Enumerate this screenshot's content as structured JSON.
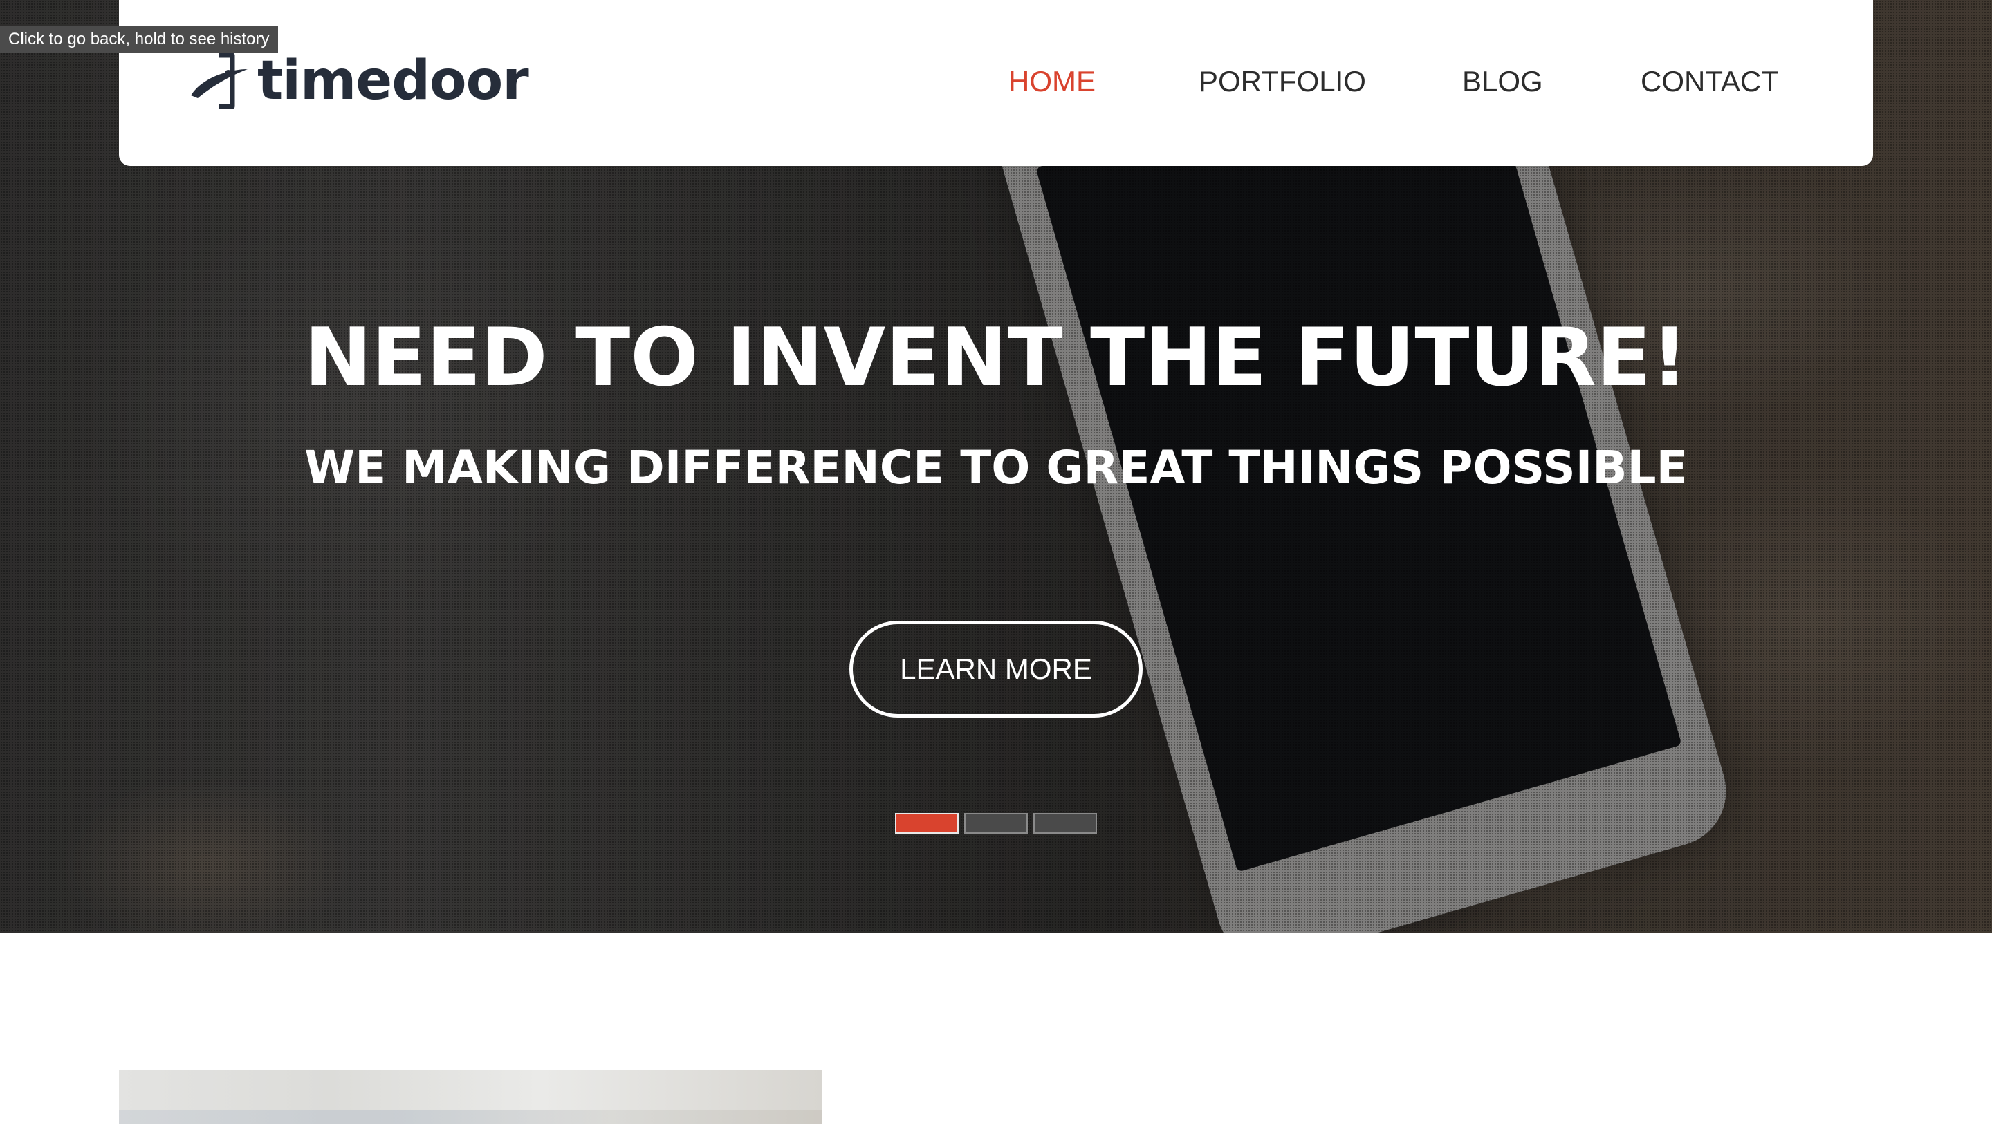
{
  "browser": {
    "back_tooltip": "Click to go back, hold to see history"
  },
  "header": {
    "logo_text": "timedoor",
    "nav": [
      {
        "label": "HOME",
        "active": true
      },
      {
        "label": "PORTFOLIO",
        "active": false
      },
      {
        "label": "BLOG",
        "active": false
      },
      {
        "label": "CONTACT",
        "active": false
      }
    ]
  },
  "hero": {
    "title": "NEED TO INVENT THE FUTURE!",
    "subtitle": "WE MAKING DIFFERENCE TO GREAT THINGS POSSIBLE",
    "cta_label": "LEARN MORE",
    "slides_count": 3,
    "active_slide": 1
  },
  "colors": {
    "accent": "#d9432e",
    "nav_text": "#2c2c2c",
    "logo": "#262d3a",
    "hero_text": "#ffffff"
  }
}
